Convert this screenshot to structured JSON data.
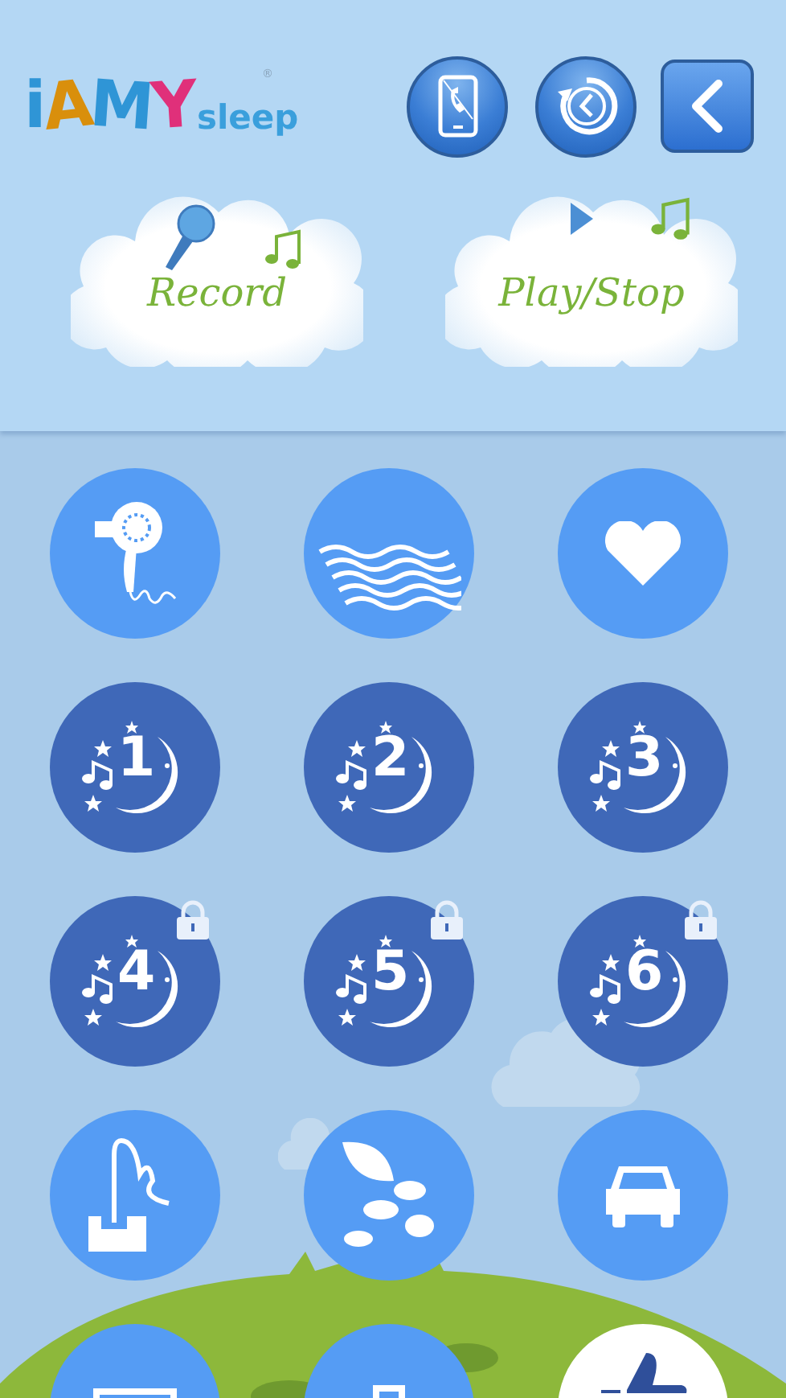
{
  "logo": {
    "brand": "iAMY",
    "registered": "®",
    "suffix": "sleep"
  },
  "header_buttons": [
    {
      "kind": "phone"
    },
    {
      "kind": "timer"
    },
    {
      "kind": "back"
    }
  ],
  "cloud_buttons": [
    {
      "kind": "record",
      "label": "Record"
    },
    {
      "kind": "play",
      "label": "Play/Stop"
    }
  ],
  "sounds": [
    {
      "kind": "hairdryer"
    },
    {
      "kind": "waves"
    },
    {
      "kind": "heart"
    },
    {
      "kind": "lullaby",
      "number": "1",
      "locked": false
    },
    {
      "kind": "lullaby",
      "number": "2",
      "locked": false
    },
    {
      "kind": "lullaby",
      "number": "3",
      "locked": false
    },
    {
      "kind": "lullaby",
      "number": "4",
      "locked": true
    },
    {
      "kind": "lullaby",
      "number": "5",
      "locked": true
    },
    {
      "kind": "lullaby",
      "number": "6",
      "locked": true
    },
    {
      "kind": "vacuum"
    },
    {
      "kind": "leaves"
    },
    {
      "kind": "car"
    },
    {
      "kind": "monitor"
    },
    {
      "kind": "bag"
    },
    {
      "kind": "like"
    }
  ]
}
